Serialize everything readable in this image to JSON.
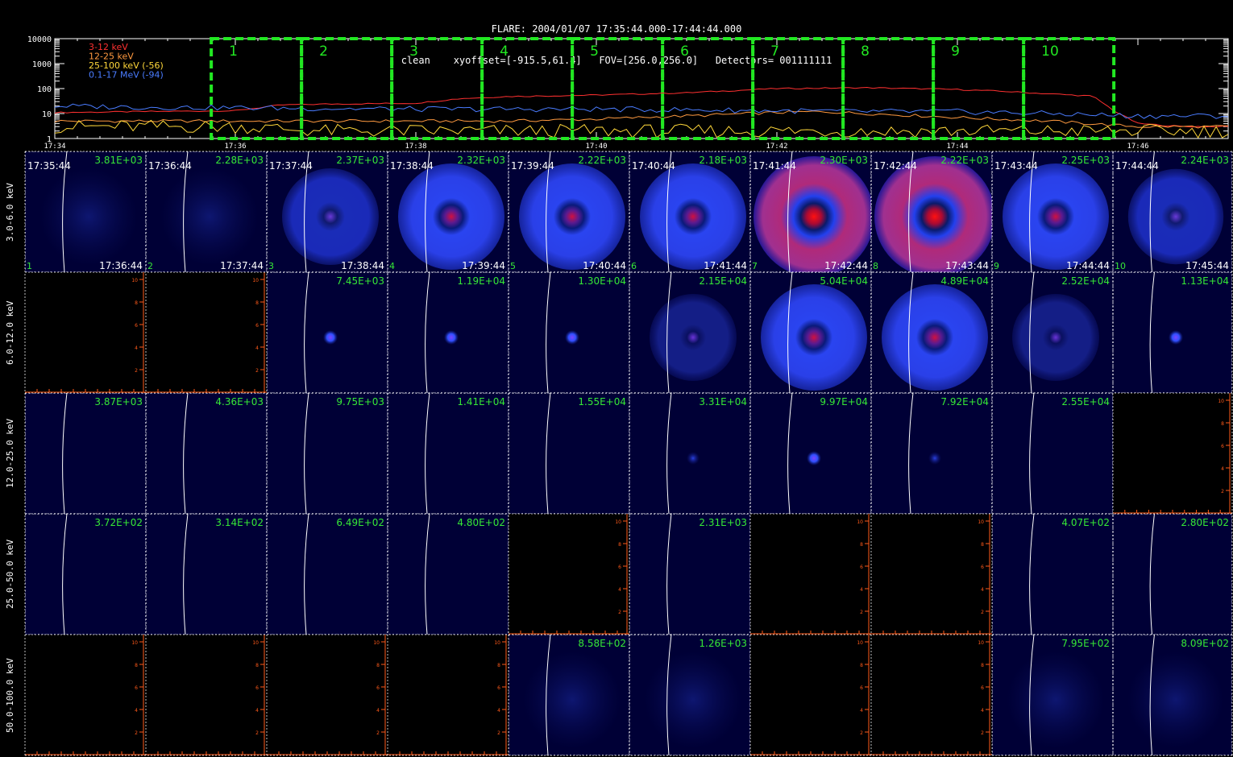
{
  "title": {
    "line1": "FLARE: 2004/01/07 17:35:44.000-17:44:44.000",
    "line2": "clean    xyoffset=[-915.5,61.4]   FOV=[256.0,256.0]   Detectors= 001111111"
  },
  "colors": {
    "band_3_12": "#ff3030",
    "band_12_25": "#ff9a40",
    "band_25_100": "#ffd83a",
    "band_01_17": "#4a7cff",
    "interval_box": "#22e822",
    "stat_text": "#36e836",
    "empty_axis": "#ff5a1a",
    "panel_bg": "#000036"
  },
  "chart_data": {
    "type": "line",
    "title": "",
    "xlabel": "",
    "ylabel": "",
    "y_scale": "log",
    "ylim": [
      1,
      10000
    ],
    "y_ticks": [
      "10000",
      "1000",
      "100",
      "10",
      "1"
    ],
    "x_range": [
      "17:34",
      "17:47"
    ],
    "x_ticks": [
      "17:34",
      "17:36",
      "17:38",
      "17:40",
      "17:42",
      "17:44",
      "17:46"
    ],
    "legend": "top-left",
    "series": [
      {
        "name": "3-12 keV",
        "x": [
          "17:34",
          "17:35",
          "17:36",
          "17:36:30",
          "17:37",
          "17:38",
          "17:38:30",
          "17:39",
          "17:40",
          "17:41",
          "17:42",
          "17:43",
          "17:44",
          "17:44:30",
          "17:45",
          "17:45:30",
          "17:45:45",
          "17:46",
          "17:46:30",
          "17:47"
        ],
        "values": [
          11,
          12,
          13,
          22,
          24,
          26,
          40,
          48,
          55,
          68,
          100,
          108,
          92,
          78,
          62,
          50,
          12,
          4,
          3,
          3
        ]
      },
      {
        "name": "12-25 keV",
        "x": [
          "17:34",
          "17:35",
          "17:36",
          "17:37",
          "17:38",
          "17:39",
          "17:40",
          "17:40:30",
          "17:41",
          "17:42",
          "17:42:30",
          "17:43",
          "17:44",
          "17:45",
          "17:46",
          "17:47"
        ],
        "values": [
          5,
          5,
          5,
          5,
          5,
          5,
          6,
          7,
          8,
          11,
          12,
          10,
          7,
          5,
          3,
          3
        ]
      },
      {
        "name": "25-100 keV (-56)",
        "x": [
          "17:34",
          "17:35",
          "17:36",
          "17:37",
          "17:38",
          "17:39",
          "17:40",
          "17:41",
          "17:42",
          "17:43",
          "17:44",
          "17:45",
          "17:46",
          "17:47"
        ],
        "values": [
          3,
          3,
          3,
          2,
          2,
          2,
          2,
          2,
          2,
          2,
          2,
          2,
          2,
          2
        ]
      },
      {
        "name": "0.1-17 MeV (-94)",
        "x": [
          "17:34",
          "17:35",
          "17:36",
          "17:37",
          "17:38",
          "17:39",
          "17:40",
          "17:41",
          "17:42",
          "17:43",
          "17:44",
          "17:45",
          "17:46",
          "17:47"
        ],
        "values": [
          20,
          18,
          17,
          16,
          15,
          15,
          15,
          14,
          13,
          12,
          12,
          10,
          8,
          8
        ]
      }
    ],
    "interval_labels": [
      "1",
      "2",
      "3",
      "4",
      "5",
      "6",
      "7",
      "8",
      "9",
      "10"
    ],
    "interval_bounds": [
      "17:35:44",
      "17:36:44",
      "17:37:44",
      "17:38:44",
      "17:39:44",
      "17:40:44",
      "17:41:44",
      "17:42:44",
      "17:43:44",
      "17:44:44",
      "17:45:44"
    ]
  },
  "image_grid": {
    "bands": [
      "3.0-6.0 keV",
      "6.0-12.0 keV",
      "12.0-25.0 keV",
      "25.0-50.0 keV",
      "50.0-100.0 keV"
    ],
    "start_times": [
      "17:35:44",
      "17:36:44",
      "17:37:44",
      "17:38:44",
      "17:39:44",
      "17:40:44",
      "17:41:44",
      "17:42:44",
      "17:43:44",
      "17:44:44"
    ],
    "end_times": [
      "17:36:44",
      "17:37:44",
      "17:38:44",
      "17:39:44",
      "17:40:44",
      "17:41:44",
      "17:42:44",
      "17:43:44",
      "17:44:44",
      "17:45:44"
    ],
    "interval_numbers": [
      "1",
      "2",
      "3",
      "4",
      "5",
      "6",
      "7",
      "8",
      "9",
      "10"
    ],
    "peak_values": [
      [
        "3.81E+03",
        "2.28E+03",
        "2.37E+03",
        "2.32E+03",
        "2.22E+03",
        "2.18E+03",
        "2.30E+03",
        "2.22E+03",
        "2.25E+03",
        "2.24E+03"
      ],
      [
        "",
        "",
        "7.45E+03",
        "1.19E+04",
        "1.30E+04",
        "2.15E+04",
        "5.04E+04",
        "4.89E+04",
        "2.52E+04",
        "1.13E+04"
      ],
      [
        "3.87E+03",
        "4.36E+03",
        "9.75E+03",
        "1.41E+04",
        "1.55E+04",
        "3.31E+04",
        "9.97E+04",
        "7.92E+04",
        "2.55E+04",
        ""
      ],
      [
        "3.72E+02",
        "3.14E+02",
        "6.49E+02",
        "4.80E+02",
        "",
        "2.31E+03",
        "",
        "",
        "4.07E+02",
        "2.80E+02"
      ],
      [
        "",
        "",
        "",
        "",
        "8.58E+02",
        "1.26E+03",
        "",
        "",
        "7.95E+02",
        "8.09E+02"
      ]
    ],
    "empty_axis_ticks": [
      "2",
      "4",
      "6",
      "8",
      "10"
    ],
    "disk": [
      [
        "faint",
        "faint",
        "ring-medium",
        "ring-bright",
        "ring-bright",
        "ring-bright",
        "ring-red",
        "ring-red",
        "ring-bright",
        "ring-medium"
      ],
      [
        "empty",
        "empty",
        "dot",
        "dot",
        "dot",
        "ring-faint",
        "ring-bright",
        "ring-bright",
        "ring-faint",
        "dot"
      ],
      [
        "none",
        "none",
        "none",
        "none",
        "none",
        "dot-faint",
        "dot",
        "dot-faint",
        "none",
        "empty"
      ],
      [
        "none",
        "none",
        "none",
        "none",
        "empty",
        "none",
        "empty",
        "empty",
        "none",
        "none"
      ],
      [
        "empty",
        "empty",
        "empty",
        "empty",
        "faint",
        "faint",
        "empty",
        "empty",
        "faint",
        "faint"
      ]
    ]
  }
}
